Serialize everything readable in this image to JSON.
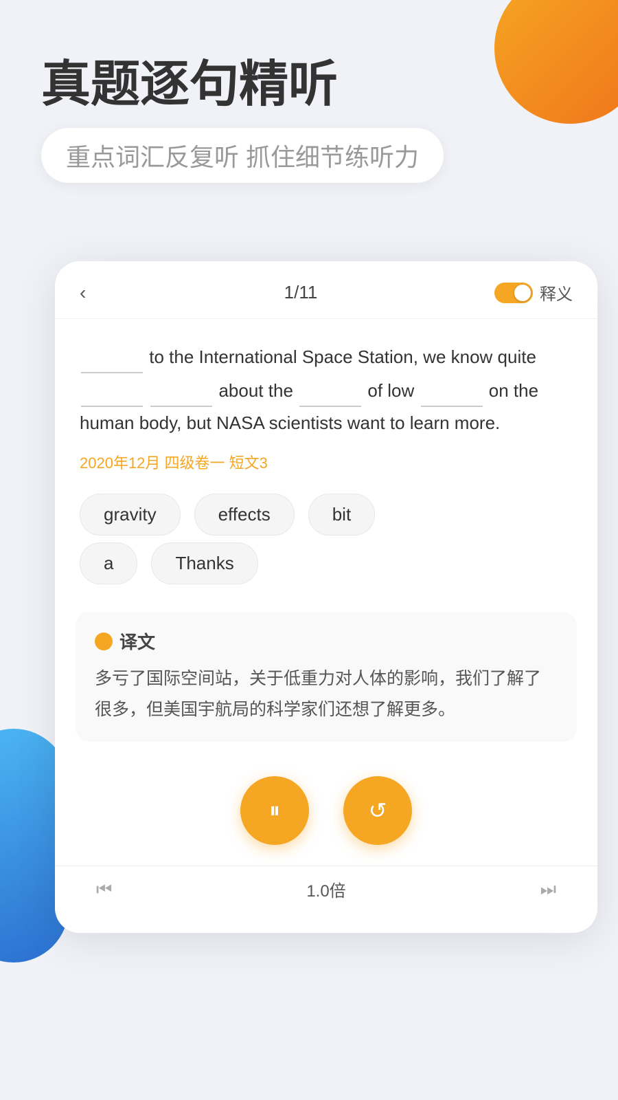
{
  "background": {
    "color": "#f0f2f7"
  },
  "header": {
    "main_title": "真题逐句精听",
    "subtitle": "重点词汇反复听  抓住细节练听力"
  },
  "nav": {
    "back_label": "‹",
    "counter": "1/11",
    "toggle_label": "释义"
  },
  "sentence": {
    "text": "_______ to the International Space Station, we know quite _______ _______ about the _______ of low _______ on the human body, but NASA scientists want to learn more.",
    "source": "2020年12月 四级卷一 短文3"
  },
  "chips": {
    "row1": [
      "gravity",
      "effects",
      "bit"
    ],
    "row2": [
      "a",
      "Thanks"
    ]
  },
  "translation": {
    "label": "译文",
    "text": "多亏了国际空间站，关于低重力对人体的影响，我们了解了很多，但美国宇航局的科学家们还想了解更多。"
  },
  "controls": {
    "pause_icon": "⏸",
    "replay_icon": "↺"
  },
  "bottom": {
    "prev_icon": "⏮",
    "speed": "1.0倍",
    "next_icon": "⏭"
  }
}
